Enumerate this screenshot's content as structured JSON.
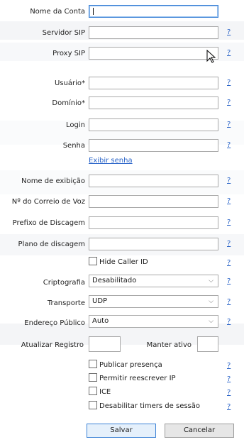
{
  "form": {
    "account_name": {
      "label": "Nome da Conta",
      "value": ""
    },
    "sip_server": {
      "label": "Servidor SIP",
      "value": ""
    },
    "sip_proxy": {
      "label": "Proxy SIP",
      "value": ""
    },
    "user": {
      "label": "Usuário",
      "required_mark": "*",
      "value": ""
    },
    "domain": {
      "label": "Domínio",
      "required_mark": "*",
      "value": ""
    },
    "login": {
      "label": "Login",
      "value": ""
    },
    "password": {
      "label": "Senha",
      "value": ""
    },
    "show_password_link": "Exibir senha",
    "display_name": {
      "label": "Nome de exibição",
      "value": ""
    },
    "voicemail": {
      "label": "Nº do Correio de Voz",
      "value": ""
    },
    "dial_prefix": {
      "label": "Prefixo de Discagem",
      "value": ""
    },
    "dial_plan": {
      "label": "Plano de discagem",
      "value": ""
    },
    "hide_caller_id": {
      "label": "Hide Caller ID",
      "checked": false
    },
    "encryption": {
      "label": "Criptografia",
      "value": "Desabilitado"
    },
    "transport": {
      "label": "Transporte",
      "value": "UDP"
    },
    "public_address": {
      "label": "Endereço Público",
      "value": "Auto"
    },
    "update_registration": {
      "label": "Atualizar Registro",
      "value": ""
    },
    "keep_alive": {
      "label": "Manter ativo",
      "value": ""
    },
    "publish_presence": {
      "label": "Publicar presença",
      "checked": false
    },
    "allow_ip_rewrite": {
      "label": "Permitir reescrever IP",
      "checked": false
    },
    "ice": {
      "label": "ICE",
      "checked": false
    },
    "disable_session_timers": {
      "label": "Desabilitar timers de sessão",
      "checked": false
    },
    "help_glyph": "?",
    "chevron_glyph": "⌵"
  },
  "buttons": {
    "save": "Salvar",
    "cancel": "Cancelar"
  },
  "colors": {
    "accent": "#3c82d6",
    "link": "#2a64c8"
  }
}
